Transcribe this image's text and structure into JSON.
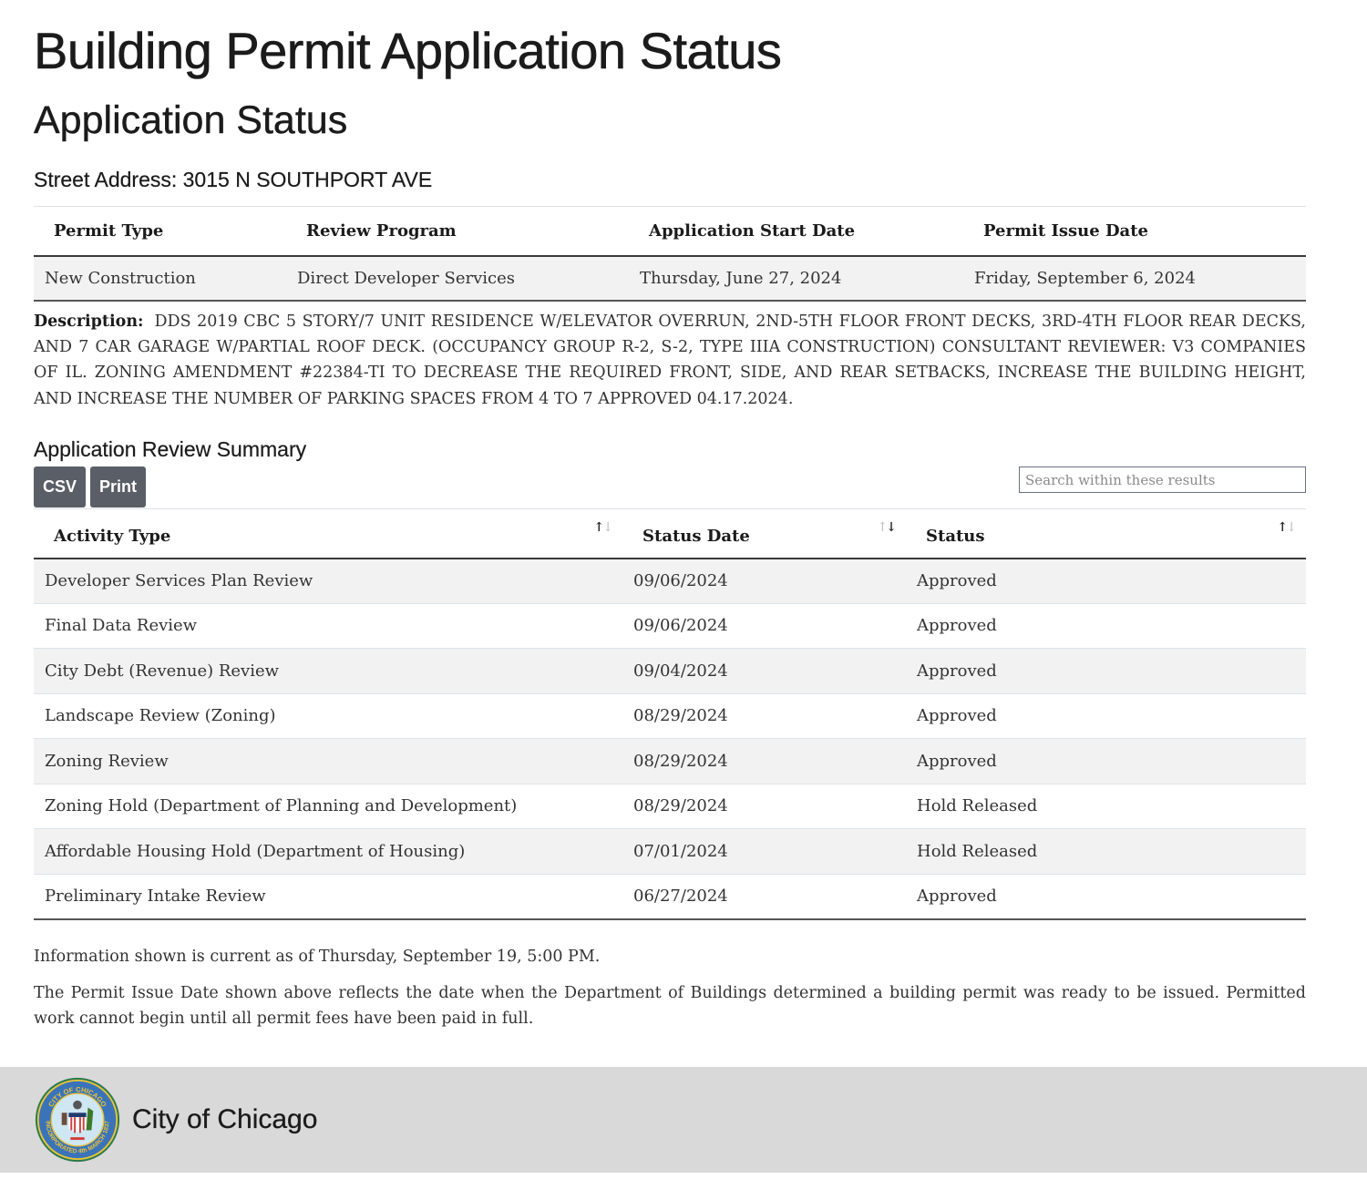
{
  "page": {
    "title": "Building Permit Application Status",
    "section_title": "Application Status",
    "street_address": "Street Address: 3015 N SOUTHPORT AVE"
  },
  "permit": {
    "headers": [
      "Permit Type",
      "Review Program",
      "Application Start Date",
      "Permit Issue Date"
    ],
    "values": [
      "New Construction",
      "Direct Developer Services",
      "Thursday, June 27, 2024",
      "Friday, September 6, 2024"
    ]
  },
  "description": {
    "label": "Description:",
    "text": "DDS 2019 CBC 5 STORY/7 UNIT RESIDENCE W/ELEVATOR OVERRUN, 2ND-5TH FLOOR FRONT DECKS, 3RD-4TH FLOOR REAR DECKS, AND 7 CAR GARAGE W/PARTIAL ROOF DECK. (OCCUPANCY GROUP R-2, S-2, TYPE IIIA CONSTRUCTION) CONSULTANT REVIEWER: V3 COMPANIES OF IL. ZONING AMENDMENT #22384-TI TO DECREASE THE REQUIRED FRONT, SIDE, AND REAR SETBACKS, INCREASE THE BUILDING HEIGHT, AND INCREASE THE NUMBER OF PARKING SPACES FROM 4 TO 7 APPROVED 04.17.2024."
  },
  "review_summary": {
    "title": "Application Review Summary",
    "buttons": {
      "csv": "CSV",
      "print": "Print"
    },
    "search": {
      "placeholder": "Search within these results",
      "value": ""
    },
    "columns": [
      {
        "label": "Activity Type",
        "sort": "none",
        "icon": "sort-arrows-icon"
      },
      {
        "label": "Status Date",
        "sort": "descending",
        "icon": "sort-arrows-icon"
      },
      {
        "label": "Status",
        "sort": "none",
        "icon": "sort-arrows-icon"
      }
    ],
    "rows": [
      {
        "activity": "Developer Services Plan Review",
        "date": "09/06/2024",
        "status": "Approved"
      },
      {
        "activity": "Final Data Review",
        "date": "09/06/2024",
        "status": "Approved"
      },
      {
        "activity": "City Debt (Revenue) Review",
        "date": "09/04/2024",
        "status": "Approved"
      },
      {
        "activity": "Landscape Review (Zoning)",
        "date": "08/29/2024",
        "status": "Approved"
      },
      {
        "activity": "Zoning Review",
        "date": "08/29/2024",
        "status": "Approved"
      },
      {
        "activity": "Zoning Hold (Department of Planning and Development)",
        "date": "08/29/2024",
        "status": "Hold Released"
      },
      {
        "activity": "Affordable Housing Hold (Department of Housing)",
        "date": "07/01/2024",
        "status": "Hold Released"
      },
      {
        "activity": "Preliminary Intake Review",
        "date": "06/27/2024",
        "status": "Approved"
      }
    ]
  },
  "notes": {
    "current_as_of": "Information shown is current as of Thursday, September 19, 5:00 PM.",
    "issue_date_note": "The Permit Issue Date shown above reflects the date when the Department of Buildings determined a building permit was ready to be issued. Permitted work cannot begin until all permit fees have been paid in full."
  },
  "footer": {
    "title": "City of Chicago",
    "logo_icon": "city-seal-icon",
    "seal_text_top": "CITY OF CHICAGO",
    "seal_text_bottom": "INCORPORATED 4th MARCH 1837"
  },
  "colors": {
    "button_bg": "#5a5e66",
    "footer_bg": "#d9d9d9",
    "stripe_bg": "#f2f2f2"
  }
}
